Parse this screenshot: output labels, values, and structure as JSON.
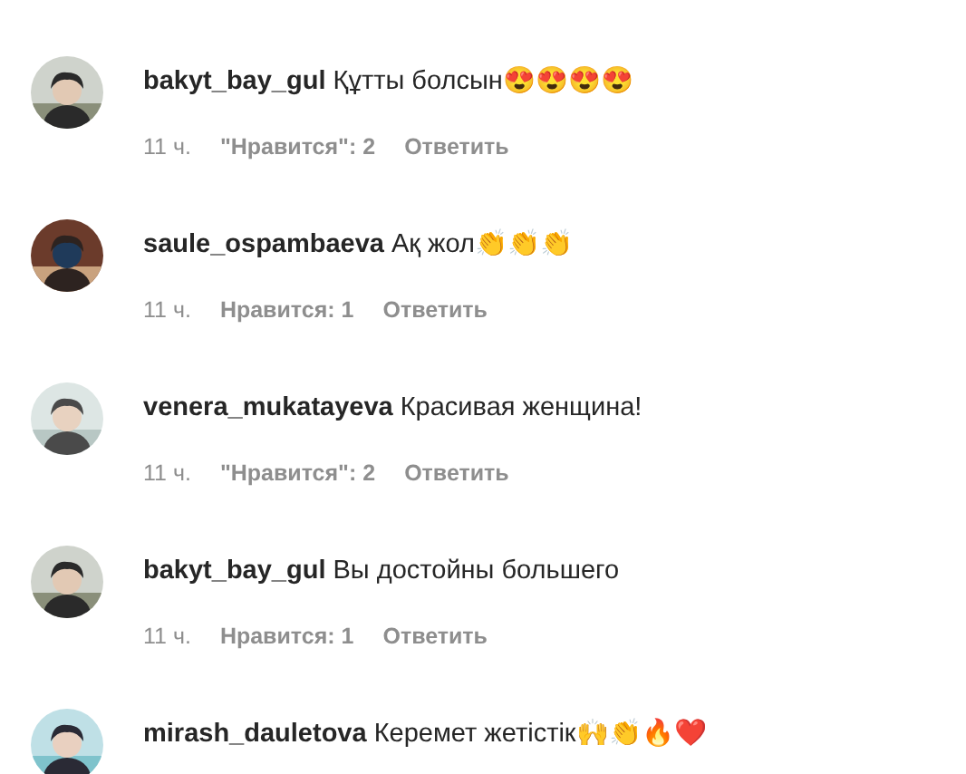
{
  "comments": [
    {
      "username": "bakyt_bay_gul",
      "text": "Құтты болсын😍😍😍😍",
      "time": "11 ч.",
      "likes": "\"Нравится\": 2",
      "reply": "Ответить"
    },
    {
      "username": "saule_ospambaeva",
      "text": "Ақ жол👏👏👏",
      "time": "11 ч.",
      "likes": "Нравится: 1",
      "reply": "Ответить"
    },
    {
      "username": "venera_mukatayeva",
      "text": "Красивая женщина!",
      "time": "11 ч.",
      "likes": "\"Нравится\": 2",
      "reply": "Ответить"
    },
    {
      "username": "bakyt_bay_gul",
      "text": "Вы достойны большего",
      "time": "11 ч.",
      "likes": "Нравится: 1",
      "reply": "Ответить"
    },
    {
      "username": "mirash_dauletova",
      "text": "Керемет жетістік🙌👏🔥❤️"
    }
  ]
}
